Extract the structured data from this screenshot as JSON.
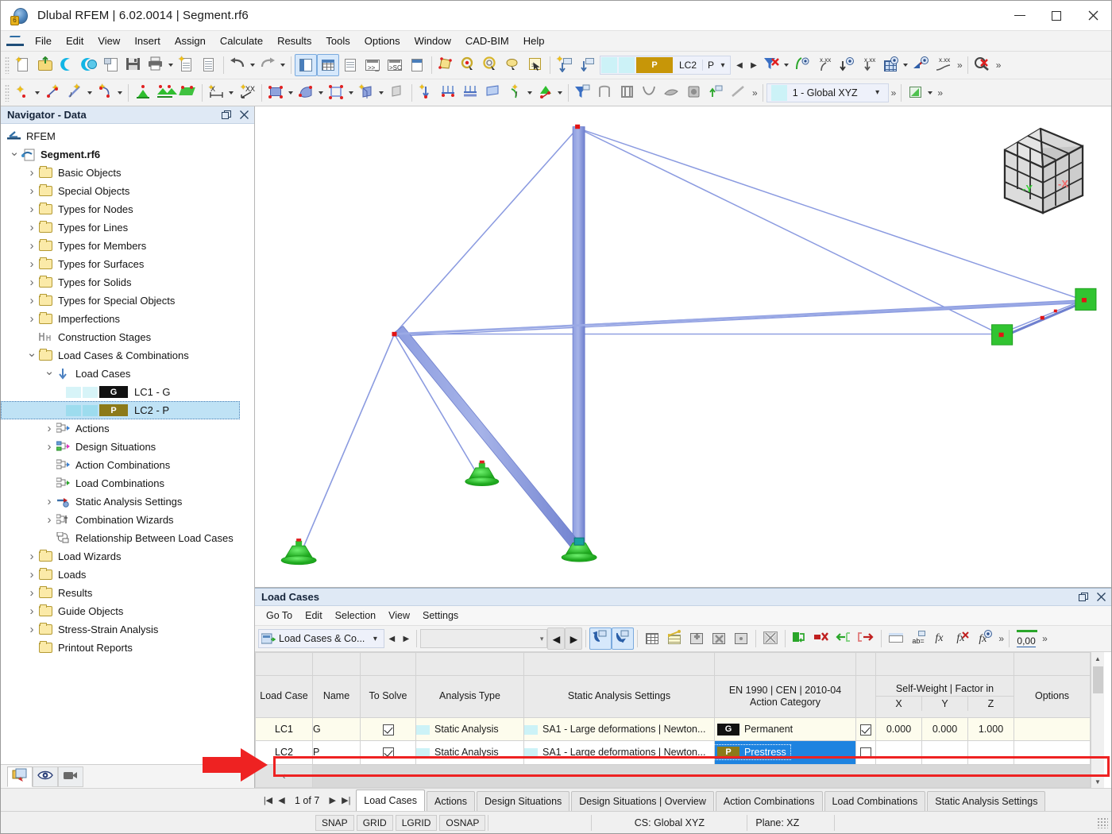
{
  "window": {
    "title": "Dlubal RFEM | 6.02.0014 | Segment.rf6",
    "minimize_label": "Minimize",
    "maximize_label": "Maximize",
    "close_label": "Close"
  },
  "menubar": {
    "items": [
      "File",
      "Edit",
      "View",
      "Insert",
      "Assign",
      "Calculate",
      "Results",
      "Tools",
      "Options",
      "Window",
      "CAD-BIM",
      "Help"
    ]
  },
  "toolbar": {
    "load_case_selector": {
      "code": "LC2",
      "short": "P",
      "tag": "P"
    },
    "coordinate_system": "1 - Global XYZ",
    "overflow_label": "»"
  },
  "navigator": {
    "title": "Navigator - Data",
    "undock_label": "Undock",
    "close_label": "Close",
    "tree": [
      {
        "label": "RFEM",
        "depth": 0,
        "icon": "rfem-icon",
        "expander": "none"
      },
      {
        "label": "Segment.rf6",
        "depth": 1,
        "icon": "model-icon",
        "expander": "open",
        "bold": true
      },
      {
        "label": "Basic Objects",
        "depth": 2,
        "icon": "folder",
        "expander": "closed"
      },
      {
        "label": "Special Objects",
        "depth": 2,
        "icon": "folder",
        "expander": "closed"
      },
      {
        "label": "Types for Nodes",
        "depth": 2,
        "icon": "folder",
        "expander": "closed"
      },
      {
        "label": "Types for Lines",
        "depth": 2,
        "icon": "folder",
        "expander": "closed"
      },
      {
        "label": "Types for Members",
        "depth": 2,
        "icon": "folder",
        "expander": "closed"
      },
      {
        "label": "Types for Surfaces",
        "depth": 2,
        "icon": "folder",
        "expander": "closed"
      },
      {
        "label": "Types for Solids",
        "depth": 2,
        "icon": "folder",
        "expander": "closed"
      },
      {
        "label": "Types for Special Objects",
        "depth": 2,
        "icon": "folder",
        "expander": "closed"
      },
      {
        "label": "Imperfections",
        "depth": 2,
        "icon": "folder",
        "expander": "closed"
      },
      {
        "label": "Construction Stages",
        "depth": 2,
        "icon": "construction-stages-icon",
        "expander": "none"
      },
      {
        "label": "Load Cases & Combinations",
        "depth": 2,
        "icon": "folder",
        "expander": "open"
      },
      {
        "label": "Load Cases",
        "depth": 3,
        "icon": "load-cases-icon",
        "expander": "open"
      },
      {
        "label": "LC1 - G",
        "depth": 4,
        "icon": "load-case-swatch",
        "expander": "none",
        "tag": "G",
        "tag_style": "g"
      },
      {
        "label": "LC2 - P",
        "depth": 4,
        "icon": "load-case-swatch",
        "expander": "none",
        "tag": "P",
        "tag_style": "p",
        "selected": true
      },
      {
        "label": "Actions",
        "depth": 3,
        "icon": "actions-icon",
        "expander": "closed"
      },
      {
        "label": "Design Situations",
        "depth": 3,
        "icon": "design-situations-icon",
        "expander": "closed"
      },
      {
        "label": "Action Combinations",
        "depth": 3,
        "icon": "action-combinations-icon",
        "expander": "none"
      },
      {
        "label": "Load Combinations",
        "depth": 3,
        "icon": "load-combinations-icon",
        "expander": "none"
      },
      {
        "label": "Static Analysis Settings",
        "depth": 3,
        "icon": "static-analysis-icon",
        "expander": "closed"
      },
      {
        "label": "Combination Wizards",
        "depth": 3,
        "icon": "combination-wizards-icon",
        "expander": "closed"
      },
      {
        "label": "Relationship Between Load Cases",
        "depth": 3,
        "icon": "relationship-icon",
        "expander": "none"
      },
      {
        "label": "Load Wizards",
        "depth": 2,
        "icon": "folder",
        "expander": "closed"
      },
      {
        "label": "Loads",
        "depth": 2,
        "icon": "folder",
        "expander": "closed"
      },
      {
        "label": "Results",
        "depth": 2,
        "icon": "folder",
        "expander": "closed"
      },
      {
        "label": "Guide Objects",
        "depth": 2,
        "icon": "folder",
        "expander": "closed"
      },
      {
        "label": "Stress-Strain Analysis",
        "depth": 2,
        "icon": "folder",
        "expander": "closed"
      },
      {
        "label": "Printout Reports",
        "depth": 2,
        "icon": "folder",
        "expander": "none"
      }
    ],
    "bottom_tabs": [
      "data-navigator-tab",
      "display-navigator-tab",
      "views-navigator-tab"
    ]
  },
  "viewport": {
    "orientation_cube": {
      "axis_left": "-Y",
      "axis_right": "-X"
    }
  },
  "dock": {
    "title": "Load Cases",
    "undock_label": "Undock",
    "close_label": "Close",
    "menu": [
      "Go To",
      "Edit",
      "Selection",
      "View",
      "Settings"
    ],
    "selector_label": "Load Cases & Co...",
    "number_format": "0,00"
  },
  "table": {
    "group_headers": {
      "action_category_group": "EN 1990 | CEN | 2010-04",
      "self_weight_group": "Self-Weight | Factor in"
    },
    "headers": {
      "load_case": "Load Case",
      "name": "Name",
      "to_solve": "To Solve",
      "analysis_type": "Analysis Type",
      "static_analysis_settings": "Static Analysis Settings",
      "action_category": "Action Category",
      "sw_active": "",
      "sw_x": "X",
      "sw_y": "Y",
      "sw_z": "Z",
      "options": "Options"
    },
    "rows": [
      {
        "load_case": "LC1",
        "name": "G",
        "to_solve": true,
        "analysis_type": "Static Analysis",
        "static_analysis_settings": "SA1 - Large deformations | Newton...",
        "action_category_tag": "G",
        "action_category": "Permanent",
        "sw_active": true,
        "sw_x": "0.000",
        "sw_y": "0.000",
        "sw_z": "1.000",
        "options": "",
        "selected": false
      },
      {
        "load_case": "LC2",
        "name": "P",
        "to_solve": true,
        "analysis_type": "Static Analysis",
        "static_analysis_settings": "SA1 - Large deformations | Newton...",
        "action_category_tag": "P",
        "action_category": "Prestress",
        "sw_active": false,
        "sw_x": "",
        "sw_y": "",
        "sw_z": "",
        "options": "",
        "selected": true
      }
    ],
    "highlight_color": "#ee2222"
  },
  "bottom_tabs": {
    "page_indicator": "1 of 7",
    "tabs": [
      "Load Cases",
      "Actions",
      "Design Situations",
      "Design Situations | Overview",
      "Action Combinations",
      "Load Combinations",
      "Static Analysis Settings"
    ],
    "active": "Load Cases"
  },
  "statusbar": {
    "buttons": [
      "SNAP",
      "GRID",
      "LGRID",
      "OSNAP"
    ],
    "coordinate_system": "CS: Global XYZ",
    "plane": "Plane: XZ"
  }
}
